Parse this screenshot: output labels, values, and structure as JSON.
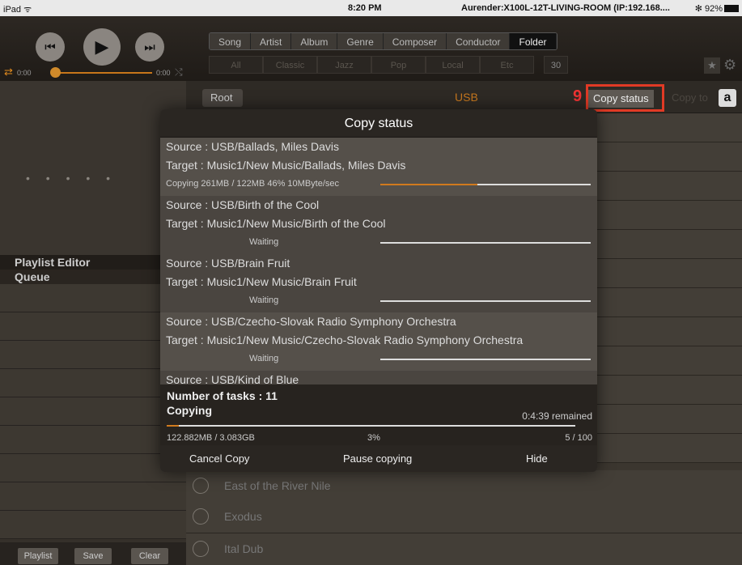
{
  "status_bar": {
    "device": "iPad ᯤ",
    "time": "8:20 PM",
    "title": "Aurender:X100L-12T-LIVING-ROOM (IP:192.168....",
    "battery": "✻ 92%"
  },
  "player": {
    "time_start": "0:00",
    "time_end": "0:00",
    "progress_percent": 0
  },
  "sidebar": {
    "dots": "• • • • •",
    "playlist_editor": "Playlist Editor",
    "queue": "Queue",
    "buttons": {
      "playlist": "Playlist",
      "save": "Save",
      "clear": "Clear"
    }
  },
  "nav": {
    "tabs": [
      {
        "label": "Song"
      },
      {
        "label": "Artist"
      },
      {
        "label": "Album"
      },
      {
        "label": "Genre"
      },
      {
        "label": "Composer"
      },
      {
        "label": "Conductor"
      },
      {
        "label": "Folder",
        "selected": true
      }
    ],
    "filters": [
      "All",
      "Classic",
      "Jazz",
      "Pop",
      "Local",
      "Etc"
    ],
    "count": "30"
  },
  "browser": {
    "root": "Root",
    "title": "USB",
    "step_number": "9",
    "copy_status": "Copy status",
    "copy_to": "Copy to",
    "a_key": "a",
    "items": [
      "East of the River Nile",
      "Exodus",
      "Ital Dub"
    ]
  },
  "modal": {
    "title": "Copy status",
    "tasks": [
      {
        "source": "Source : USB/Ballads, Miles Davis",
        "target": "Target : Music1/New Music/Ballads, Miles Davis",
        "status": "Copying 261MB / 122MB 46% 10MByte/sec",
        "progress_percent": 46
      },
      {
        "source": "Source : USB/Birth of the Cool",
        "target": "Target : Music1/New Music/Birth of the Cool",
        "status": "Waiting",
        "progress_percent": 0
      },
      {
        "source": "Source : USB/Brain Fruit",
        "target": "Target : Music1/New Music/Brain Fruit",
        "status": "Waiting",
        "progress_percent": 0
      },
      {
        "source": "Source : USB/Czecho-Slovak Radio Symphony Orchestra",
        "target": "Target : Music1/New Music/Czecho-Slovak Radio Symphony Orchestra",
        "status": "Waiting",
        "progress_percent": 0
      }
    ],
    "partial_task": "Source : USB/Kind of Blue",
    "summary": {
      "tasks": "Number of tasks : 11",
      "state": "Copying",
      "remaining": "0:4:39 remained",
      "size": "122.882MB / 3.083GB",
      "percent": "3%",
      "count": "5 / 100",
      "progress_percent": 3
    },
    "buttons": {
      "cancel": "Cancel Copy",
      "pause": "Pause copying",
      "hide": "Hide"
    }
  },
  "colors": {
    "accent": "#d07a1e",
    "highlight": "#e13a25"
  }
}
